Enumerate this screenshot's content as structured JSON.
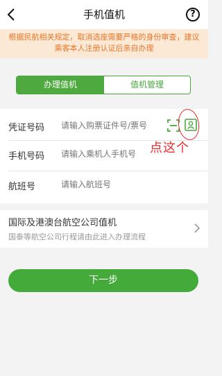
{
  "header": {
    "title": "手机值机",
    "help_glyph": "?"
  },
  "notice": {
    "text": "根据民航相关规定，取消选座需要严格的身份审查，建议乘客本人注册认证后亲自办理"
  },
  "tabs": [
    {
      "label": "办理值机",
      "active": true
    },
    {
      "label": "值机管理",
      "active": false
    }
  ],
  "form": {
    "id_label": "凭证号码",
    "id_placeholder": "请输入购票证件号/票号",
    "phone_label": "手机号码",
    "phone_placeholder": "请输入乘机人手机号",
    "flight_label": "航班号",
    "flight_placeholder": "请输入航班号"
  },
  "annotation": {
    "text": "点这个"
  },
  "international": {
    "title": "国际及港澳台航空公司值机",
    "subtitle": "国泰等航空公司行程请由此进入办理流程"
  },
  "next_button": {
    "label": "下一步"
  },
  "colors": {
    "accent": "#44ab3a",
    "notice_text": "#e8762a",
    "notice_bg": "#fbe9d6",
    "annotation": "#e52b2b"
  }
}
